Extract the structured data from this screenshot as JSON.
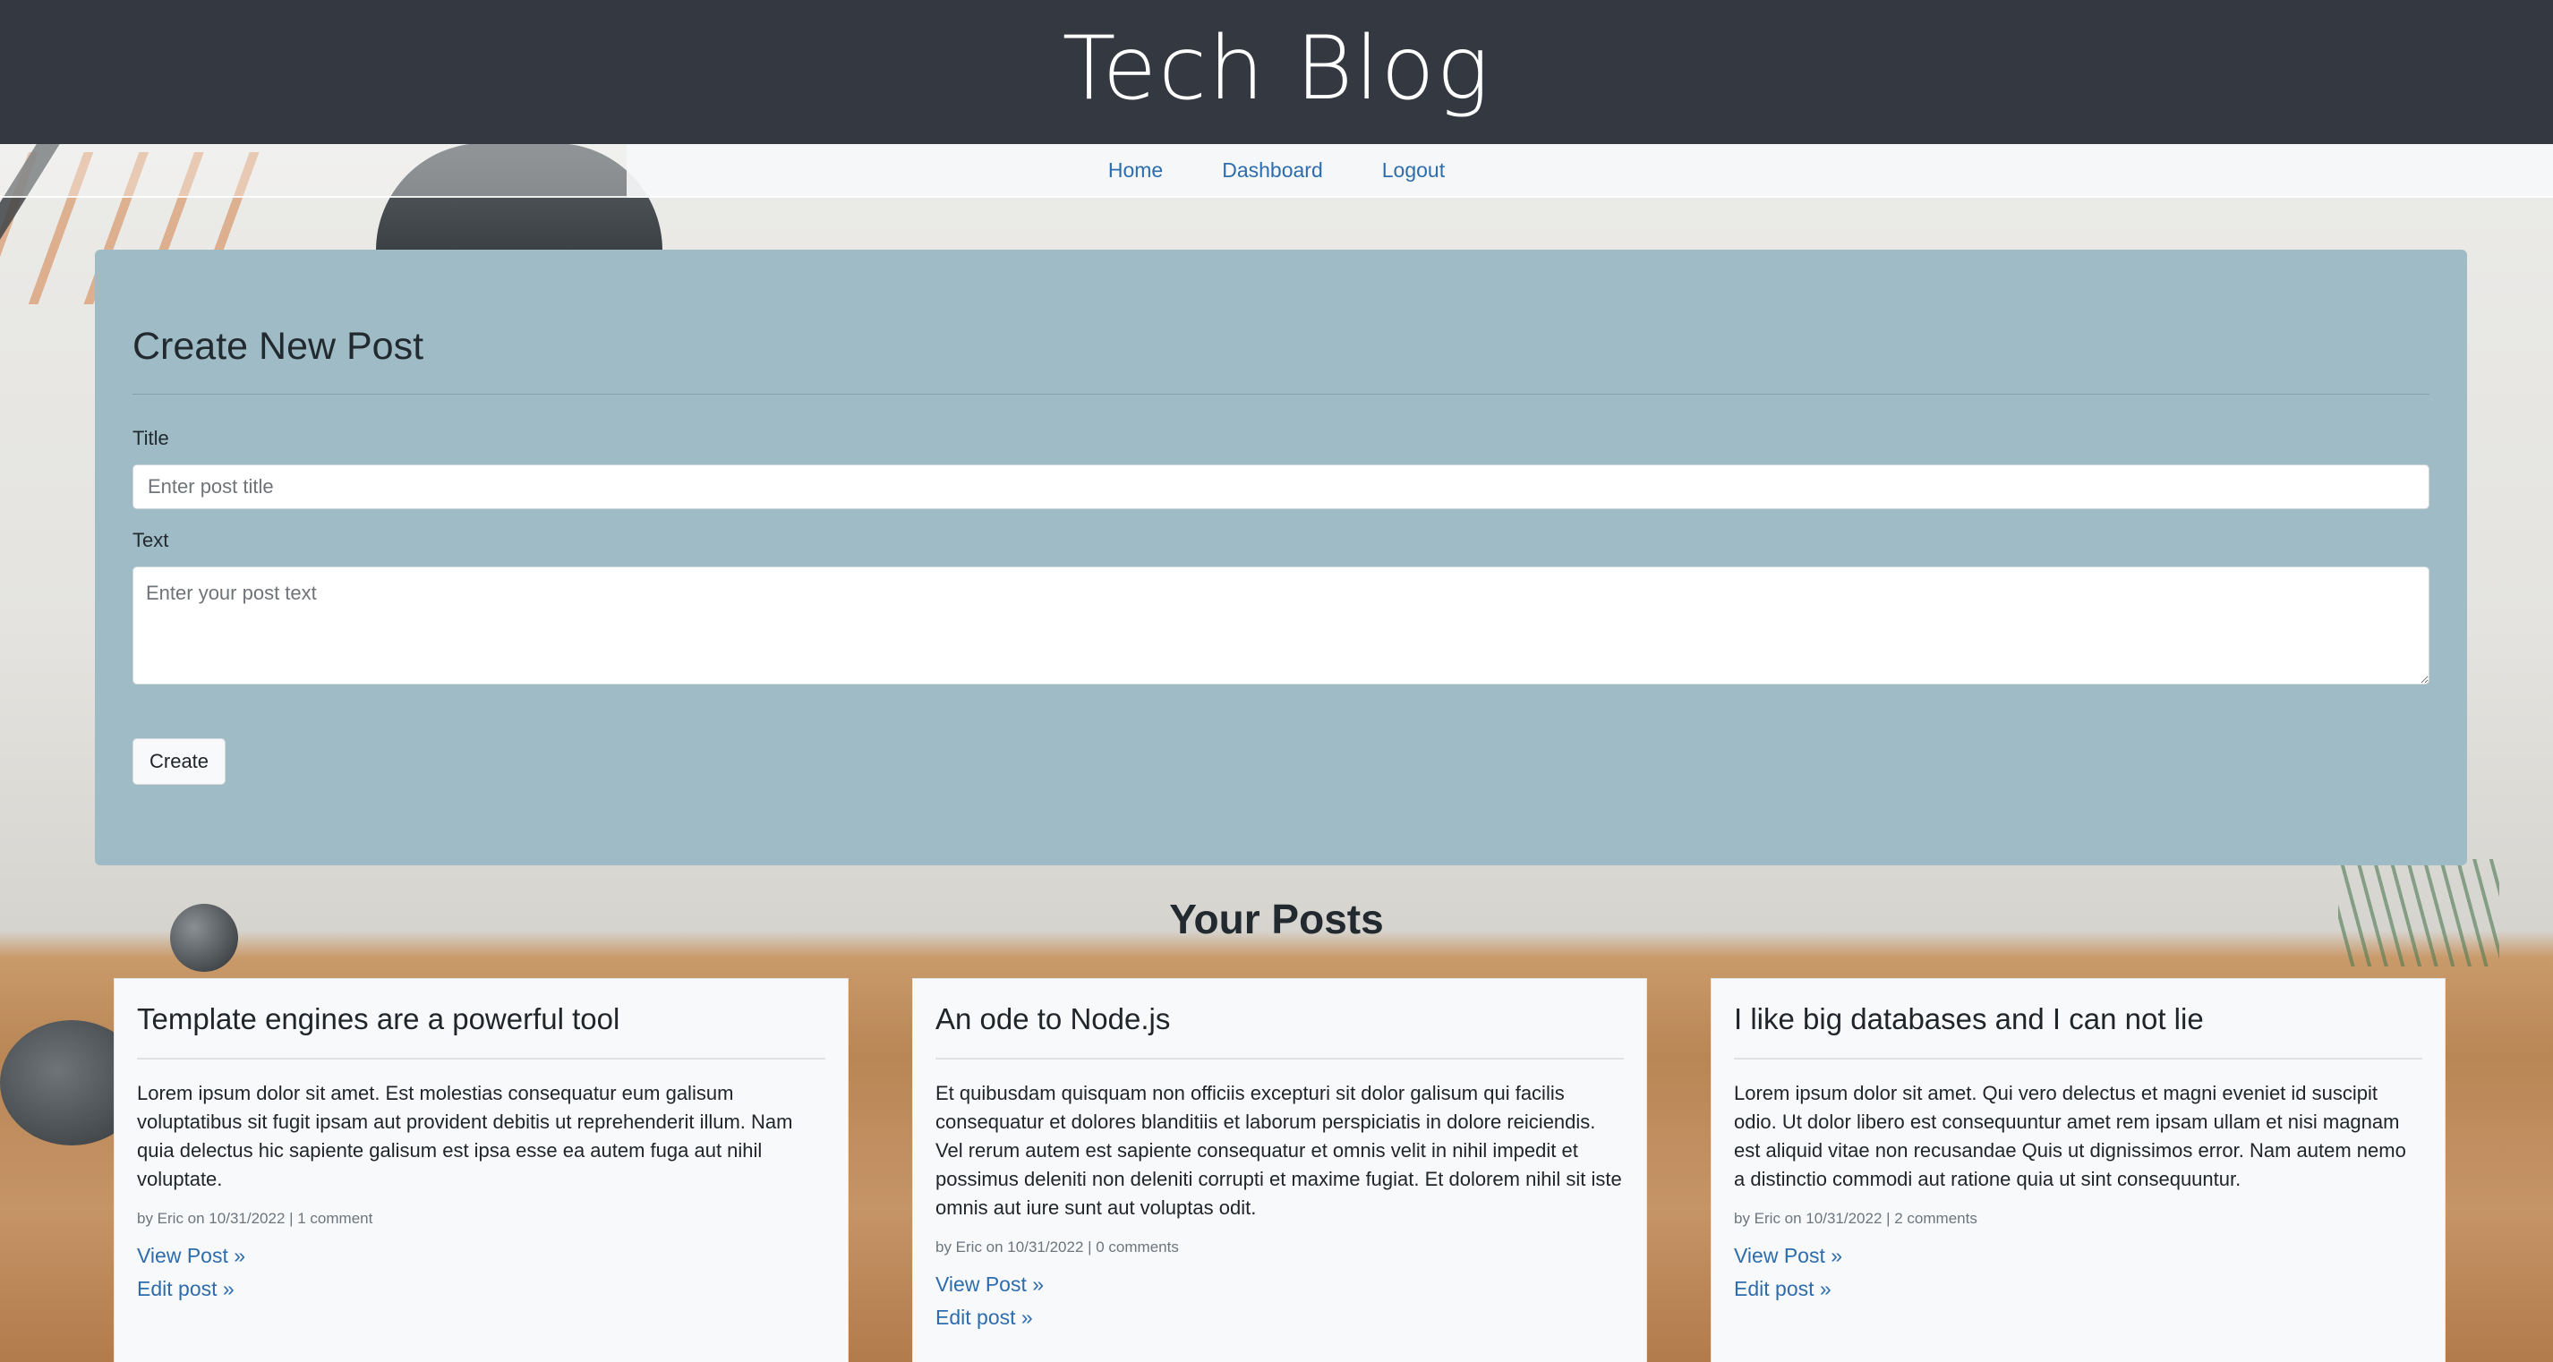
{
  "site": {
    "title": "Tech Blog"
  },
  "nav": {
    "home": "Home",
    "dashboard": "Dashboard",
    "logout": "Logout"
  },
  "create_post": {
    "heading": "Create New Post",
    "title_label": "Title",
    "title_placeholder": "Enter post title",
    "text_label": "Text",
    "text_placeholder": "Enter your post text",
    "create_button": "Create"
  },
  "posts_section": {
    "heading": "Your Posts"
  },
  "posts": [
    {
      "title": "Template engines are a powerful tool",
      "body": "Lorem ipsum dolor sit amet. Est molestias consequatur eum galisum voluptatibus sit fugit ipsam aut provident debitis ut reprehenderit illum. Nam quia delectus hic sapiente galisum est ipsa esse ea autem fuga aut nihil voluptate.",
      "meta": "by Eric on 10/31/2022 | 1 comment",
      "view_link": "View Post »",
      "edit_link": "Edit post »"
    },
    {
      "title": "An ode to Node.js",
      "body": "Et quibusdam quisquam non officiis excepturi sit dolor galisum qui facilis consequatur et dolores blanditiis et laborum perspiciatis in dolore reiciendis. Vel rerum autem est sapiente consequatur et omnis velit in nihil impedit et possimus deleniti non deleniti corrupti et maxime fugiat. Et dolorem nihil sit iste omnis aut iure sunt aut voluptas odit.",
      "meta": "by Eric on 10/31/2022 | 0 comments",
      "view_link": "View Post »",
      "edit_link": "Edit post »"
    },
    {
      "title": "I like big databases and I can not lie",
      "body": "Lorem ipsum dolor sit amet. Qui vero delectus et magni eveniet id suscipit odio. Ut dolor libero est consequuntur amet rem ipsam ullam et nisi magnam est aliquid vitae non recusandae Quis ut dignissimos error. Nam autem nemo a distinctio commodi aut ratione quia ut sint consequuntur.",
      "meta": "by Eric on 10/31/2022 | 2 comments",
      "view_link": "View Post »",
      "edit_link": "Edit post »"
    }
  ],
  "colors": {
    "header_bg": "#333841",
    "panel_bg": "#9fbcc6",
    "link": "#2d6cad",
    "card_bg": "#f8f9fa"
  }
}
